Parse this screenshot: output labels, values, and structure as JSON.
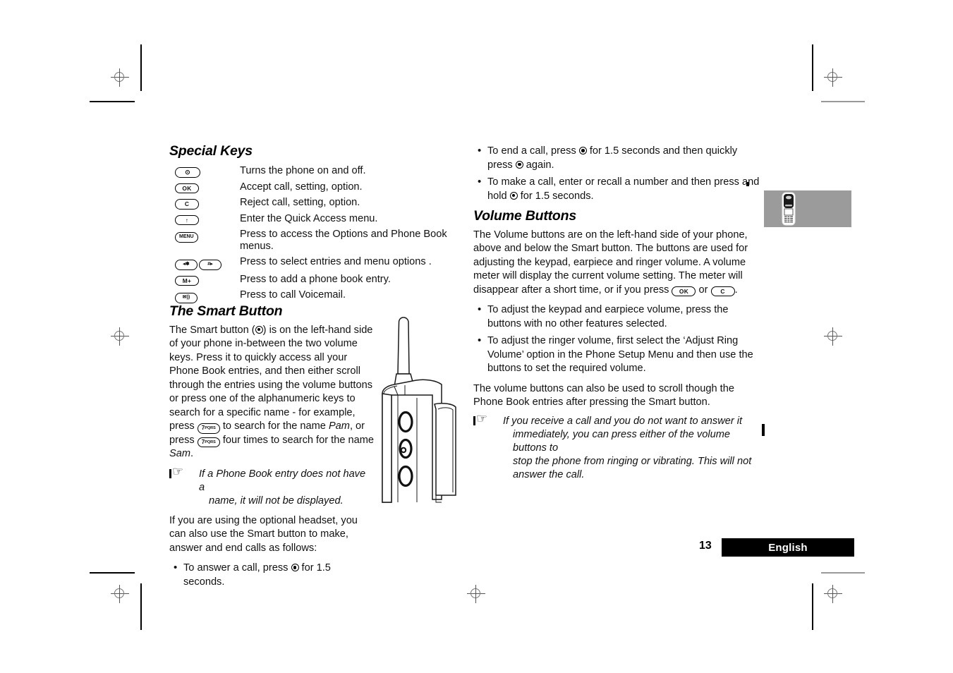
{
  "page": {
    "number": "13",
    "language_label": "English"
  },
  "left_column": {
    "special_keys": {
      "heading": "Special Keys",
      "rows": [
        {
          "key": "power-key",
          "key_label": "⊙",
          "description": "Turns the phone on and off."
        },
        {
          "key": "ok-key",
          "key_label": "OK",
          "description": "Accept call, setting, option."
        },
        {
          "key": "clear-key",
          "key_label": "C",
          "description": "Reject call, setting, option."
        },
        {
          "key": "up-arrow-key",
          "key_label": "↑",
          "description": "Enter the Quick Access menu."
        },
        {
          "key": "menu-key",
          "key_label": "MENU",
          "description": "Press to access the Options and Phone Book menus."
        },
        {
          "key": "star-hash-keys",
          "key_label": "◂✽",
          "key_label2": "#▸",
          "description": "Press to select entries and menu options ."
        },
        {
          "key": "memory-plus-key",
          "key_label": "M+",
          "description": "Press to add a phone book entry."
        },
        {
          "key": "voicemail-key",
          "key_label": "✉))",
          "description": "Press to call Voicemail."
        }
      ]
    },
    "smart_button": {
      "heading": "The Smart Button",
      "paragraph_1_part_1": "The Smart button (",
      "paragraph_1_part_2": ") is on the left-hand side of your phone in-between the two volume keys. Press it to quickly access all your Phone Book entries, and then either scroll through the entries using the volume buttons or press one of the alphanumeric keys to search for a specific name - for example, press ",
      "key_7_label": "7",
      "key_7_sub": "PQRS",
      "paragraph_1_part_3": " to search for the name ",
      "italic_name_1": "Pam",
      "paragraph_1_part_4": ", or press ",
      "paragraph_1_part_5": " four times to search for the name ",
      "italic_name_2": "Sam",
      "paragraph_1_part_6": ".",
      "note": "If a Phone Book entry does not have a name, it will not be displayed.",
      "note_line_1": "If a Phone Book entry does not have a",
      "note_line_2": "name, it will not be displayed.",
      "paragraph_2": "If you are using the optional headset, you can also use the Smart button to make, answer and end calls as follows:",
      "bullet_1_part_1": "To answer a call, press ",
      "bullet_1_part_2": " for 1.5 seconds."
    }
  },
  "right_column": {
    "call_bullets": [
      {
        "part_1": "To end a call, press ",
        "part_2": " for 1.5 seconds and then quickly press ",
        "part_3": " again."
      },
      {
        "part_1": "To make a call, enter or recall a number and then press and hold ",
        "part_2": " for 1.5 seconds."
      }
    ],
    "volume_buttons": {
      "heading": "Volume Buttons",
      "paragraph_1_part_1": "The Volume buttons are on the left-hand side of your phone, above and below the Smart button. The buttons are used for adjusting the keypad, earpiece and ringer volume. A volume meter will display the current volume setting. The meter will disappear after a short time, or if you press ",
      "ok_key_label": "OK",
      "paragraph_1_part_2": " or ",
      "clear_key_label": "C",
      "paragraph_1_part_3": ".",
      "bullets": [
        "To adjust the keypad and earpiece volume, press the buttons with no other features selected.",
        "To adjust the ringer volume, first select the ‘Adjust Ring Volume’ option in the Phone Setup Menu and then use the buttons to set the required volume."
      ],
      "paragraph_2": "The volume buttons can also be used to scroll though the Phone Book entries after pressing the Smart button.",
      "note_line_1": "If you receive a call and you do not want to answer it",
      "note_line_2": "immediately, you can press either of the volume buttons to",
      "note_line_3": "stop the phone from ringing or vibrating. This will not",
      "note_line_4": "answer the call."
    }
  },
  "illustrations": {
    "phone_side_view": "phone-side-view-with-volume-and-smart-buttons",
    "thumbnail_phone": "phone-thumbnail-icon"
  },
  "colors": {
    "thumbnail_background": "#9b9b9b",
    "footer_background": "#000000",
    "footer_text": "#ffffff",
    "body_text": "#111111"
  }
}
